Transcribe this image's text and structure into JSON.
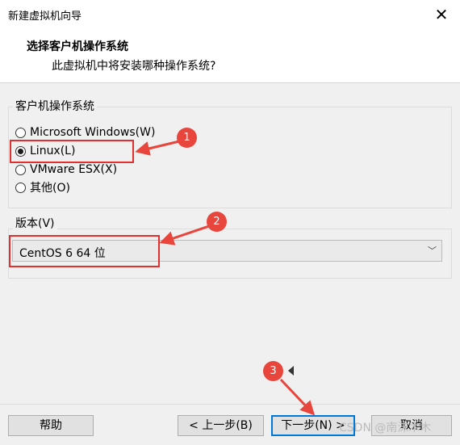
{
  "window": {
    "title": "新建虚拟机向导",
    "close_glyph": "✕"
  },
  "header": {
    "title": "选择客户机操作系统",
    "subtitle": "此虚拟机中将安装哪种操作系统?"
  },
  "guest_os_group": {
    "label": "客户机操作系统",
    "options": [
      {
        "label": "Microsoft Windows(W)",
        "checked": false
      },
      {
        "label": "Linux(L)",
        "checked": true
      },
      {
        "label": "VMware ESX(X)",
        "checked": false
      },
      {
        "label": "其他(O)",
        "checked": false
      }
    ]
  },
  "version_group": {
    "label": "版本(V)",
    "selected": "CentOS 6 64 位",
    "arrow_glyph": "﹀"
  },
  "buttons": {
    "help": "帮助",
    "back": "< 上一步(B)",
    "next": "下一步(N) >",
    "cancel": "取消"
  },
  "annotations": {
    "badge1": "1",
    "badge2": "2",
    "badge3": "3",
    "color": "#e8453c"
  },
  "watermark": "CSDN @南沫木木"
}
